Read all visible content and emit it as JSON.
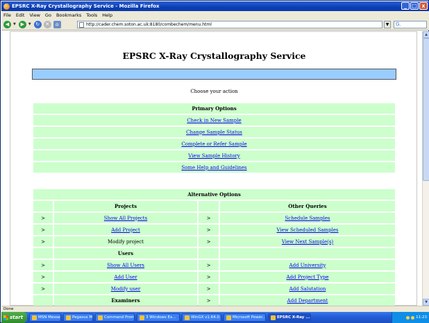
{
  "window": {
    "title": "EPSRC X-Ray Crystallography Service - Mozilla Firefox",
    "controls": {
      "minimize": "_",
      "maximize": "□",
      "close": "x"
    }
  },
  "menubar": {
    "items": [
      "File",
      "Edit",
      "View",
      "Go",
      "Bookmarks",
      "Tools",
      "Help"
    ]
  },
  "navbar": {
    "url": "http://cader.chem.soton.ac.uk:8180/combechem/menu.html",
    "search_glyph": "G."
  },
  "page": {
    "heading": "EPSRC X-Ray Crystallography Service",
    "prompt": "Choose your action",
    "primary": {
      "header": "Primary Options",
      "links": [
        "Check in New Sample",
        "Change Sample Status",
        "Complete or Refer Sample",
        "View Sample History",
        "Some Help and Guidelines"
      ]
    },
    "alternative": {
      "header": "Alternative Options",
      "col_left_header": "Projects",
      "col_right_header": "Other Queries",
      "marker": ">",
      "rows": [
        {
          "left": "Show All Projects",
          "left_link": true,
          "left_bold": false,
          "left_marker": true,
          "right": "Schedule Samples",
          "right_marker": true
        },
        {
          "left": "Add Project",
          "left_link": true,
          "left_bold": false,
          "left_marker": true,
          "right": "View Scheduled Samples",
          "right_marker": true
        },
        {
          "left": "Modify project",
          "left_link": false,
          "left_bold": false,
          "left_marker": true,
          "right": "View Next Sample(s)",
          "right_marker": true
        },
        {
          "left": "Users",
          "left_link": false,
          "left_bold": true,
          "left_marker": false,
          "right": "",
          "right_marker": false
        },
        {
          "left": "Show All Users",
          "left_link": true,
          "left_bold": false,
          "left_marker": true,
          "right": "Add University",
          "right_marker": true
        },
        {
          "left": "Add User",
          "left_link": true,
          "left_bold": false,
          "left_marker": true,
          "right": "Add Project Type",
          "right_marker": true
        },
        {
          "left": "Modify user",
          "left_link": true,
          "left_bold": false,
          "left_marker": true,
          "right": "Add Salutation",
          "right_marker": true
        },
        {
          "left": "Examiners",
          "left_link": false,
          "left_bold": true,
          "left_marker": false,
          "right": "Add Department",
          "right_marker": true
        }
      ]
    }
  },
  "statusbar": {
    "text": "Done"
  },
  "taskbar": {
    "start": "start",
    "tasks": [
      {
        "label": "MSN Messenger",
        "active": false
      },
      {
        "label": "Pegasus Mail",
        "active": false
      },
      {
        "label": "Command Prompt",
        "active": false
      },
      {
        "label": "3 Windows Ex...",
        "active": false
      },
      {
        "label": "WinGX v1.64.0...",
        "active": false
      },
      {
        "label": "Microsoft Power...",
        "active": false
      },
      {
        "label": "EPSRC X-Ray ...",
        "active": true
      }
    ],
    "clock": "11:23"
  },
  "colors": {
    "table_cell": "#ccffcc",
    "banner": "#99ccff",
    "link": "#0000ee"
  }
}
